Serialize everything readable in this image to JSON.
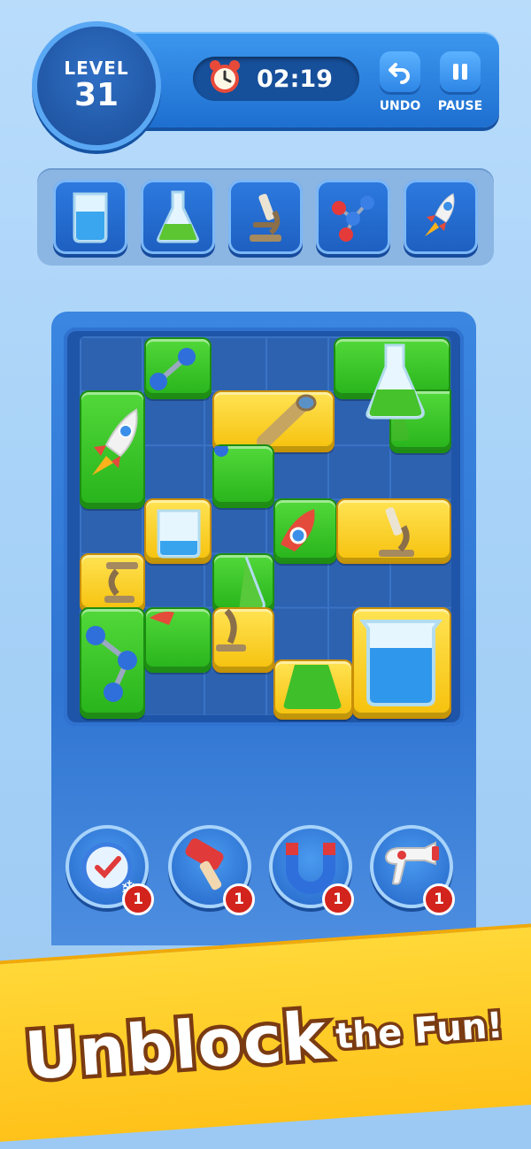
{
  "hud": {
    "level_label": "LEVEL",
    "level_number": "31",
    "timer": "02:19",
    "undo_label": "UNDO",
    "pause_label": "PAUSE"
  },
  "targets": [
    "beaker-icon",
    "flask-icon",
    "microscope-icon",
    "molecule-icon",
    "rocket-icon"
  ],
  "board": {
    "columns": 6,
    "rows": 7,
    "block_colors": {
      "green": "#34c223",
      "yellow": "#f9cf1a"
    }
  },
  "boosters": [
    {
      "name": "time-freeze",
      "count": "1"
    },
    {
      "name": "hammer",
      "count": "1"
    },
    {
      "name": "magnet",
      "count": "1"
    },
    {
      "name": "blaster",
      "count": "1"
    }
  ],
  "banner": {
    "text_big": "Unblock",
    "text_small": "the Fun!"
  },
  "colors": {
    "accent_blue": "#2e86e6",
    "banner_yellow": "#ffc21a",
    "badge_red": "#d2241c"
  }
}
